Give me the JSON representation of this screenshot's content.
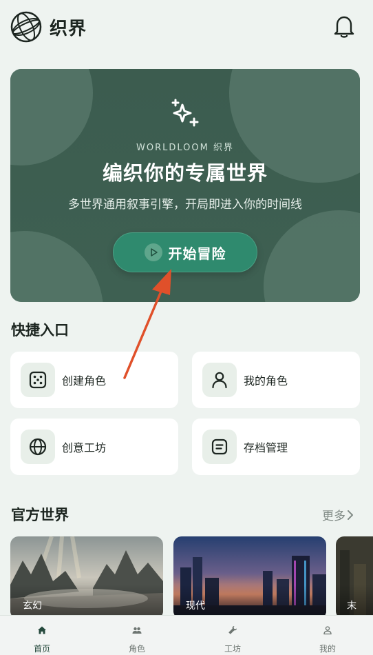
{
  "header": {
    "app_title": "织界",
    "logo_icon": "globe-logo-icon",
    "bell_icon": "bell-icon"
  },
  "hero": {
    "brand": "WORLDLOOM 织界",
    "title": "编织你的专属世界",
    "subtitle": "多世界通用叙事引擎，开局即进入你的时间线",
    "start_button": "开始冒险",
    "icon": "sparkle-icon",
    "bg_color": "#3c5c4f",
    "button_color": "#2f8a6e"
  },
  "quick_entry": {
    "title": "快捷入口",
    "items": [
      {
        "label": "创建角色",
        "icon": "dice-icon"
      },
      {
        "label": "我的角色",
        "icon": "user-icon"
      },
      {
        "label": "创意工坊",
        "icon": "globe-icon"
      },
      {
        "label": "存档管理",
        "icon": "archive-icon"
      }
    ]
  },
  "official_worlds": {
    "title": "官方世界",
    "more": "更多",
    "cards": [
      {
        "label": "玄幻"
      },
      {
        "label": "现代"
      },
      {
        "label": "末"
      }
    ]
  },
  "tabbar": {
    "items": [
      {
        "label": "首页",
        "icon": "home-icon",
        "active": true
      },
      {
        "label": "角色",
        "icon": "users-icon",
        "active": false
      },
      {
        "label": "工坊",
        "icon": "wrench-icon",
        "active": false
      },
      {
        "label": "我的",
        "icon": "person-icon",
        "active": false
      }
    ]
  }
}
